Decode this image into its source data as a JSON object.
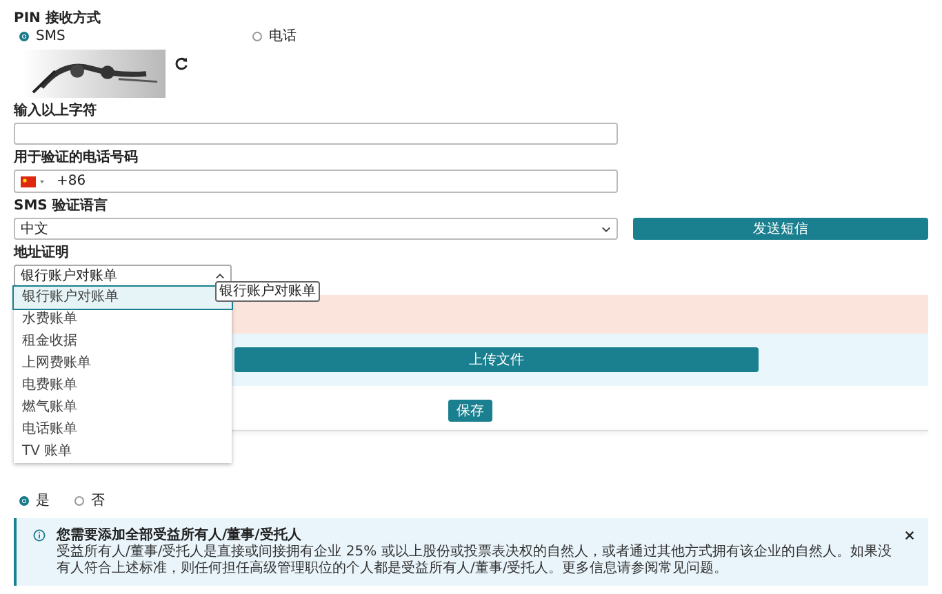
{
  "pin_method": {
    "label": "PIN 接收方式",
    "options": [
      {
        "label": "SMS",
        "selected": true
      },
      {
        "label": "电话",
        "selected": false
      }
    ]
  },
  "captcha_input": {
    "label": "输入以上字符"
  },
  "phone": {
    "label": "用于验证的电话号码",
    "value": "+86"
  },
  "sms_language": {
    "label": "SMS 验证语言",
    "value": "中文"
  },
  "send_button": "发送短信",
  "address_proof": {
    "label": "地址证明",
    "value": "银行账户对账单",
    "expanded": true,
    "options": [
      {
        "label": "银行账户对账单",
        "selected": true
      },
      {
        "label": "水费账单",
        "selected": false
      },
      {
        "label": "租金收据",
        "selected": false
      },
      {
        "label": "上网费账单",
        "selected": false
      },
      {
        "label": "电费账单",
        "selected": false
      },
      {
        "label": "燃气账单",
        "selected": false
      },
      {
        "label": "电话账单",
        "selected": false
      },
      {
        "label": "TV 账单",
        "selected": false
      }
    ]
  },
  "tooltip": "银行账户对账单",
  "upload_button": "上传文件",
  "save_button": "保存",
  "beneficial_owner": {
    "options": [
      {
        "label": "是",
        "selected": true
      },
      {
        "label": "否",
        "selected": false
      }
    ]
  },
  "info": {
    "title": "您需要添加全部受益所有人/董事/受托人",
    "text": "受益所有人/董事/受托人是直接或间接拥有企业 25% 或以上股份或投票表决权的自然人，或者通过其他方式拥有该企业的自然人。如果没有人符合上述标准，则任何担任高级管理职位的个人都是受益所有人/董事/受托人。更多信息请参阅常见问题。"
  }
}
